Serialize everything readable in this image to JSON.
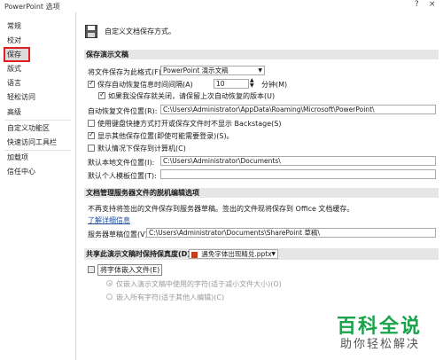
{
  "window": {
    "title": "PowerPoint 选项",
    "help_icon": "?",
    "close_icon": "×"
  },
  "sidebar": {
    "items": [
      {
        "label": "常规"
      },
      {
        "label": "校对"
      },
      {
        "label": "保存"
      },
      {
        "label": "版式"
      },
      {
        "label": "语言"
      },
      {
        "label": "轻松访问"
      },
      {
        "label": "高级"
      },
      {
        "label": "自定义功能区"
      },
      {
        "label": "快速访问工具栏"
      },
      {
        "label": "加载项"
      },
      {
        "label": "信任中心"
      }
    ],
    "selected": "保存",
    "highlight_color": "#e02020"
  },
  "banner": {
    "text": "自定义文档保存方式。",
    "icon": "floppy-disk-icon"
  },
  "save_presentations": {
    "header": "保存演示文稿",
    "format_label": "将文件保存为此格式(F):",
    "format_value": "PowerPoint 演示文稿",
    "autorecover_label": "保存自动恢复信息时间间隔(A)",
    "autorecover_checked": true,
    "autorecover_minutes": "10",
    "minutes_label": "分钟(M)",
    "keep_last_label": "如果我没保存就关闭，请保留上次自动恢复的版本(U)",
    "keep_last_checked": true,
    "autorecover_location_label": "自动恢复文件位置(R):",
    "autorecover_location_value": "C:\\Users\\Administrator\\AppData\\Roaming\\Microsoft\\PowerPoint\\",
    "backstage_label": "使用键盘快捷方式打开或保存文件时不显示 Backstage(S)",
    "backstage_checked": false,
    "show_more_label": "显示其他保存位置(即使可能需要登录)(S)。",
    "show_more_checked": true,
    "save_computer_label": "默认情况下保存到计算机(C)",
    "save_computer_checked": false,
    "local_location_label": "默认本地文件位置(I):",
    "local_location_value": "C:\\Users\\Administrator\\Documents\\",
    "personal_templates_label": "默认个人模板位置(T):",
    "personal_templates_value": ""
  },
  "offline": {
    "header": "文档管理服务器文件的脱机编辑选项",
    "description": "不再支持将签出的文件保存到服务器草稿。签出的文件现将保存到 Office 文档缓存。",
    "learn_more": "了解详细信息",
    "drafts_label": "服务器草稿位置(V):",
    "drafts_value": "C:\\Users\\Administrator\\Documents\\SharePoint 草稿\\"
  },
  "fidelity": {
    "header": "共享此演示文稿时保持保真度(D):",
    "file_value": "遇免字体出现精兑.pptx",
    "embed_fonts_label": "将字体嵌入文件(E)",
    "embed_fonts_checked": false,
    "option1_label": "仅嵌入演示文稿中使用的字符(适于减小文件大小)(O)",
    "option1_selected": true,
    "option2_label": "嵌入所有字符(适于其他人编辑)(C)",
    "option2_selected": false
  },
  "watermark": {
    "line1": "百科全说",
    "line2": "助你轻松解决",
    "color": "#19a34a"
  }
}
